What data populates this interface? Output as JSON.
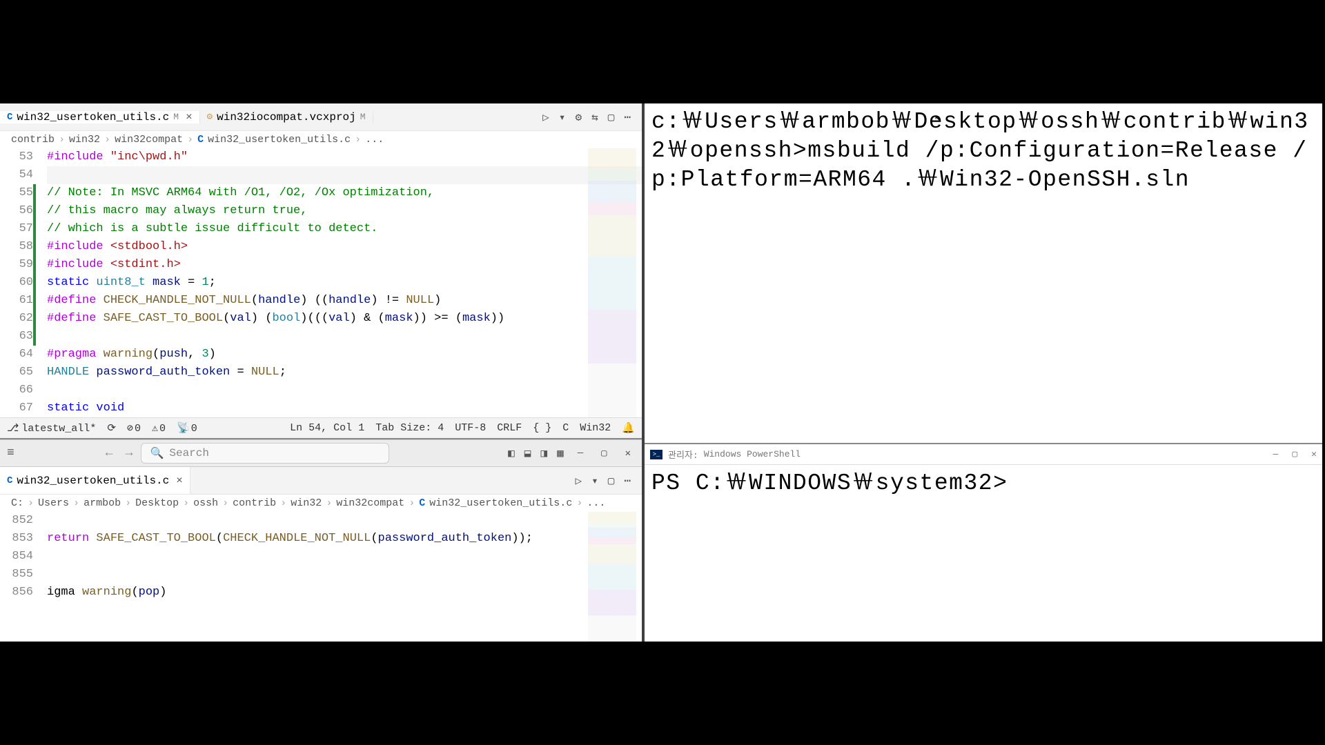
{
  "editor_top": {
    "tabs": [
      {
        "icon": "C",
        "name": "win32_usertoken_utils.c",
        "mod": "M",
        "close": "×",
        "active": true
      },
      {
        "icon": "⚙",
        "name": "win32iocompat.vcxproj",
        "mod": "M",
        "close": "",
        "active": false
      }
    ],
    "actions": {
      "run": "▷",
      "gear": "⚙",
      "compare": "⇆",
      "split": "▢",
      "more": "⋯"
    },
    "breadcrumb": [
      "contrib",
      "win32",
      "win32compat",
      "win32_usertoken_utils.c",
      "..."
    ],
    "line_start": 53,
    "lines": [
      {
        "n": 53,
        "tokens": [
          [
            "pp",
            "#include"
          ],
          [
            "op",
            " "
          ],
          [
            "str",
            "\"inc\\pwd.h\""
          ]
        ]
      },
      {
        "n": 54,
        "tokens": [],
        "active": true
      },
      {
        "n": 55,
        "tokens": [
          [
            "com",
            "// Note: In MSVC ARM64 with /O1, /O2, /Ox optimization,"
          ]
        ],
        "git": true
      },
      {
        "n": 56,
        "tokens": [
          [
            "com",
            "// this macro may always return true,"
          ]
        ],
        "git": true
      },
      {
        "n": 57,
        "tokens": [
          [
            "com",
            "// which is a subtle issue difficult to detect."
          ]
        ],
        "git": true
      },
      {
        "n": 58,
        "tokens": [
          [
            "pp",
            "#include"
          ],
          [
            "op",
            " "
          ],
          [
            "str",
            "<stdbool.h>"
          ]
        ],
        "git": true
      },
      {
        "n": 59,
        "tokens": [
          [
            "pp",
            "#include"
          ],
          [
            "op",
            " "
          ],
          [
            "str",
            "<stdint.h>"
          ]
        ],
        "git": true
      },
      {
        "n": 60,
        "tokens": [
          [
            "key",
            "static"
          ],
          [
            "op",
            " "
          ],
          [
            "type",
            "uint8_t"
          ],
          [
            "op",
            " "
          ],
          [
            "var",
            "mask"
          ],
          [
            "op",
            " = "
          ],
          [
            "num",
            "1"
          ],
          [
            "op",
            ";"
          ]
        ],
        "git": true
      },
      {
        "n": 61,
        "tokens": [
          [
            "pp",
            "#define"
          ],
          [
            "op",
            " "
          ],
          [
            "def",
            "CHECK_HANDLE_NOT_NULL"
          ],
          [
            "op",
            "("
          ],
          [
            "var",
            "handle"
          ],
          [
            "op",
            ") (("
          ],
          [
            "var",
            "handle"
          ],
          [
            "op",
            ") != "
          ],
          [
            "def",
            "NULL"
          ],
          [
            "op",
            ")"
          ]
        ],
        "git": true
      },
      {
        "n": 62,
        "tokens": [
          [
            "pp",
            "#define"
          ],
          [
            "op",
            " "
          ],
          [
            "def",
            "SAFE_CAST_TO_BOOL"
          ],
          [
            "op",
            "("
          ],
          [
            "var",
            "val"
          ],
          [
            "op",
            ") ("
          ],
          [
            "type",
            "bool"
          ],
          [
            "op",
            ")((("
          ],
          [
            "var",
            "val"
          ],
          [
            "op",
            ") & ("
          ],
          [
            "var",
            "mask"
          ],
          [
            "op",
            ")) >= ("
          ],
          [
            "var",
            "mask"
          ],
          [
            "op",
            "))"
          ]
        ],
        "git": true
      },
      {
        "n": 63,
        "tokens": [],
        "git": true
      },
      {
        "n": 64,
        "tokens": [
          [
            "pp",
            "#pragma"
          ],
          [
            "op",
            " "
          ],
          [
            "def",
            "warning"
          ],
          [
            "op",
            "("
          ],
          [
            "var",
            "push"
          ],
          [
            "op",
            ", "
          ],
          [
            "num",
            "3"
          ],
          [
            "op",
            ")"
          ]
        ]
      },
      {
        "n": 65,
        "tokens": [
          [
            "type",
            "HANDLE"
          ],
          [
            "op",
            " "
          ],
          [
            "var",
            "password_auth_token"
          ],
          [
            "op",
            " = "
          ],
          [
            "def",
            "NULL"
          ],
          [
            "op",
            ";"
          ]
        ]
      },
      {
        "n": 66,
        "tokens": []
      },
      {
        "n": 67,
        "tokens": [
          [
            "key",
            "static"
          ],
          [
            "op",
            " "
          ],
          [
            "key",
            "void"
          ]
        ]
      }
    ],
    "status": {
      "branch": "latestw_all*",
      "errors": "0",
      "warnings": "0",
      "ports": "0",
      "cursor": "Ln 54, Col 1",
      "tabsize": "Tab Size: 4",
      "encoding": "UTF-8",
      "eol": "CRLF",
      "braces": "{ }",
      "language": "C",
      "platform": "Win32"
    }
  },
  "mid_toolbar": {
    "search_placeholder": "Search",
    "winctrls": {
      "min": "—",
      "max": "▢",
      "close": "✕"
    }
  },
  "editor_bot": {
    "tab": {
      "icon": "C",
      "name": "win32_usertoken_utils.c",
      "close": "×"
    },
    "actions": {
      "run": "▷",
      "split": "▢",
      "more": "⋯"
    },
    "breadcrumb": [
      "C:",
      "Users",
      "armbob",
      "Desktop",
      "ossh",
      "contrib",
      "win32",
      "win32compat",
      "win32_usertoken_utils.c",
      "..."
    ],
    "lines": [
      {
        "n": 852,
        "tokens": []
      },
      {
        "n": 853,
        "tokens": [
          [
            "pp",
            "return"
          ],
          [
            "op",
            " "
          ],
          [
            "def",
            "SAFE_CAST_TO_BOOL"
          ],
          [
            "op",
            "("
          ],
          [
            "def",
            "CHECK_HANDLE_NOT_NULL"
          ],
          [
            "op",
            "("
          ],
          [
            "var",
            "password_auth_token"
          ],
          [
            "op",
            "));"
          ]
        ]
      },
      {
        "n": 854,
        "tokens": []
      },
      {
        "n": 855,
        "tokens": []
      },
      {
        "n": 856,
        "tokens": [
          [
            "op",
            "igma "
          ],
          [
            "def",
            "warning"
          ],
          [
            "op",
            "("
          ],
          [
            "var",
            "pop"
          ],
          [
            "op",
            ")"
          ]
        ]
      }
    ]
  },
  "cmd_top": {
    "text": "c:￦Users￦armbob￦Desktop￦ossh￦contrib￦win32￦openssh>msbuild /p:Configuration=Release /p:Platform=ARM64 .￦Win32-OpenSSH.sln"
  },
  "powershell": {
    "title_prefix": "관리자:",
    "title": "Windows PowerShell",
    "prompt": "PS C:￦WINDOWS￦system32>",
    "winctrls": {
      "min": "—",
      "max": "▢",
      "close": "✕"
    }
  }
}
